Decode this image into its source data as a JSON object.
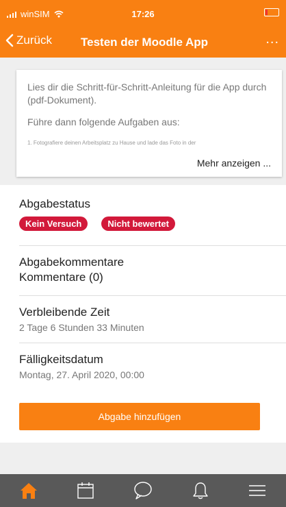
{
  "status_bar": {
    "carrier": "winSIM",
    "time": "17:26"
  },
  "header": {
    "back_label": "Zurück",
    "title": "Testen der Moodle App",
    "more_label": "..."
  },
  "intro": {
    "paragraph1": "Lies dir die Schritt-für-Schritt-Anleitung für die App durch (pdf-Dokument).",
    "paragraph2": "Führe dann folgende Aufgaben aus:",
    "paragraph3": "1. Fotografiere deinen Arbeitsplatz zu Hause und lade das Foto in der",
    "more_link": "Mehr anzeigen ..."
  },
  "submission_status": {
    "title": "Abgabestatus",
    "badges": [
      "Kein Versuch",
      "Nicht bewertet"
    ]
  },
  "comments": {
    "title": "Abgabekommentare",
    "value": "Kommentare (0)"
  },
  "remaining_time": {
    "title": "Verbleibende Zeit",
    "value": "2 Tage 6 Stunden 33 Minuten"
  },
  "due_date": {
    "title": "Fälligkeitsdatum",
    "value": "Montag, 27. April 2020, 00:00"
  },
  "submit_button": {
    "label": "Abgabe hinzufügen"
  },
  "tabs": [
    "home-icon",
    "calendar-icon",
    "messages-icon",
    "notifications-icon",
    "menu-icon"
  ],
  "colors": {
    "accent": "#f98012",
    "badge": "#d2193a",
    "tab_bar": "#595959",
    "tab_active": "#f98012",
    "tab_inactive": "#ffffff"
  }
}
